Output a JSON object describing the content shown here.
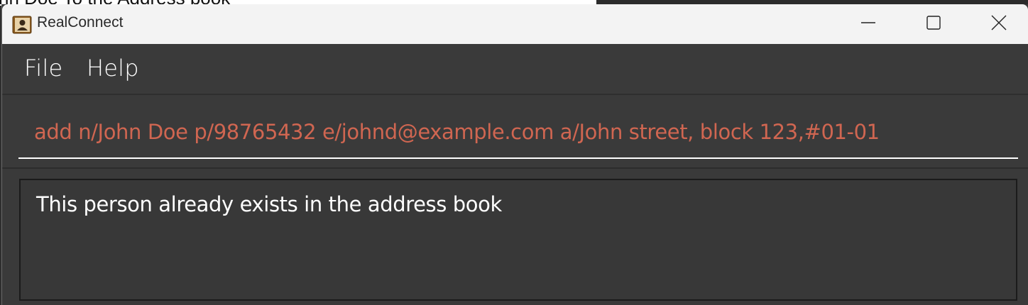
{
  "background_window": {
    "text": "hn Doe  To the Address book"
  },
  "window": {
    "title": "RealConnect",
    "icon": "contacts-book-icon",
    "controls": [
      "minimize-icon",
      "maximize-icon",
      "close-icon"
    ]
  },
  "menu": {
    "items": [
      {
        "label": "File"
      },
      {
        "label": "Help"
      }
    ]
  },
  "command_box": {
    "value": "add n/John Doe p/98765432 e/johnd@example.com a/John street, block 123,#01-01",
    "text_color": "#d06651"
  },
  "result_display": {
    "message": "This person already exists in the address book"
  },
  "colors": {
    "titlebar": "#f3f3f3",
    "app_background": "#3a3a3a",
    "error_text": "#d06651",
    "text": "#ffffff"
  }
}
